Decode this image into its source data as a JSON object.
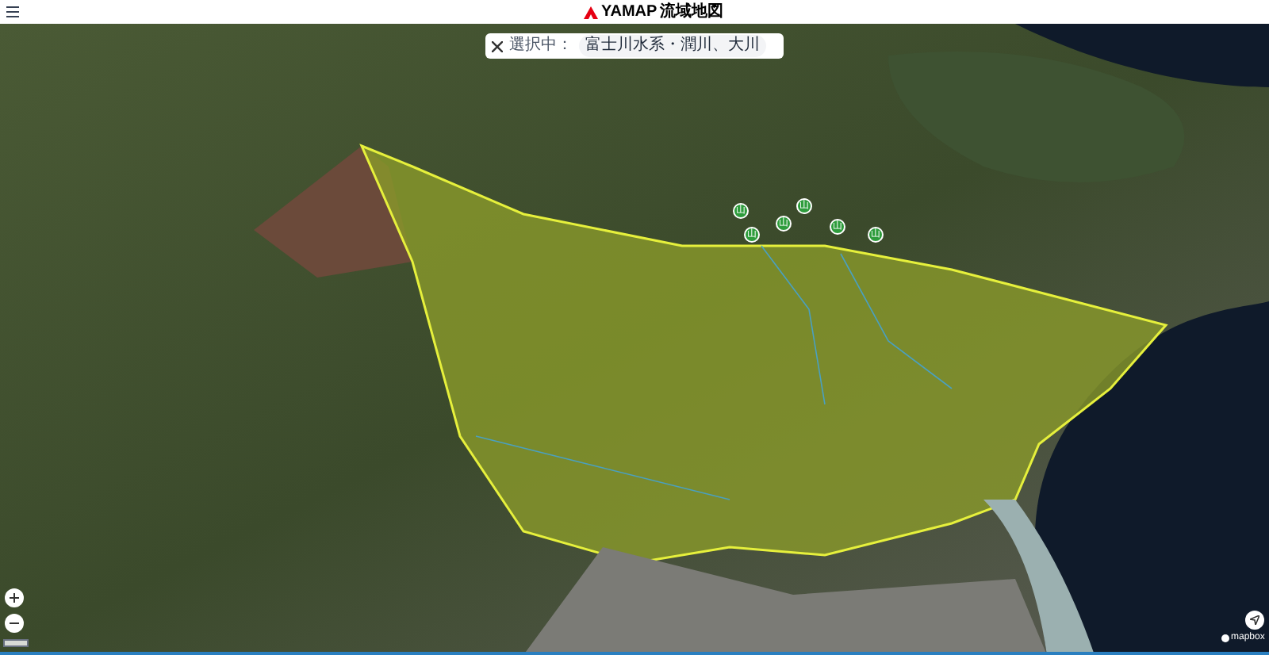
{
  "header": {
    "logo_text": "YAMAP",
    "title": "流域地図"
  },
  "selection": {
    "label": "選択中：",
    "chip": "富士川水系・潤川、大川"
  },
  "map": {
    "attribution": "mapbox",
    "peak_markers": [
      {
        "label": "山"
      },
      {
        "label": "山"
      },
      {
        "label": "山"
      },
      {
        "label": "山"
      },
      {
        "label": "山"
      },
      {
        "label": "山"
      }
    ]
  }
}
